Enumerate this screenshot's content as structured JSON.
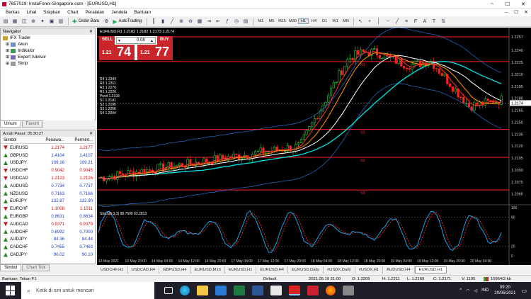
{
  "window": {
    "title": "7657019: InstaForex-Singapore.com - [EURUSD,H1]",
    "min": "–",
    "max": "☐",
    "close": "✕"
  },
  "menu": [
    "Berkas",
    "Lihat",
    "Sisipkan",
    "Chart",
    "Peralatan",
    "Jendela",
    "Bantuan"
  ],
  "toolbar": {
    "order_label": "Order Baru",
    "autotrading_label": "AutoTrading",
    "timeframes": [
      "M1",
      "M5",
      "M15",
      "M30",
      "H1",
      "H4",
      "D1",
      "W1",
      "MN"
    ],
    "active_tf": "H1"
  },
  "navigator": {
    "title": "Navigator",
    "items": [
      "IFX Trader",
      "Akun",
      "Indikator",
      "Expert Advisor",
      "Skrip"
    ],
    "tabs": [
      "Umum",
      "Favorit"
    ]
  },
  "market_watch": {
    "title": "Amati Pasar: 05:30:27",
    "columns": [
      "Simbol",
      "Penawa...",
      "Permint..."
    ],
    "rows": [
      {
        "sym": "EURUSD",
        "bid": "1.2174",
        "ask": "1.2177",
        "dir": "dn"
      },
      {
        "sym": "GBPUSD",
        "bid": "1.4104",
        "ask": "1.4107",
        "dir": "up"
      },
      {
        "sym": "USDJPY",
        "bid": "109.18",
        "ask": "109.21",
        "dir": "up"
      },
      {
        "sym": "USDCHF",
        "bid": "0.9042",
        "ask": "0.9045",
        "dir": "dn"
      },
      {
        "sym": "USDCAD",
        "bid": "1.2123",
        "ask": "1.2126",
        "dir": "dn"
      },
      {
        "sym": "AUDUSD",
        "bid": "0.7734",
        "ask": "0.7737",
        "dir": "up"
      },
      {
        "sym": "NZDUSD",
        "bid": "0.7163",
        "ask": "0.7166",
        "dir": "up"
      },
      {
        "sym": "EURJPY",
        "bid": "132.87",
        "ask": "132.90",
        "dir": "up"
      },
      {
        "sym": "EURCHF",
        "bid": "1.1008",
        "ask": "1.1011",
        "dir": "dn"
      },
      {
        "sym": "EURGBP",
        "bid": "0.8631",
        "ask": "0.8634",
        "dir": "up"
      },
      {
        "sym": "AUDCAD",
        "bid": "0.9371",
        "ask": "0.9379",
        "dir": "dn"
      },
      {
        "sym": "AUDCHF",
        "bid": "0.6992",
        "ask": "0.7000",
        "dir": "up"
      },
      {
        "sym": "AUDJPY",
        "bid": "84.36",
        "ask": "84.44",
        "dir": "up"
      },
      {
        "sym": "CADCHF",
        "bid": "0.7455",
        "ask": "0.7463",
        "dir": "up"
      },
      {
        "sym": "CADJPY",
        "bid": "90.02",
        "ask": "90.10",
        "dir": "up"
      }
    ],
    "tabs": [
      "Simbol",
      "Chart Tick"
    ]
  },
  "chart": {
    "info": "EURUSD,H1  1.2182 1.2182 1.2173 1.2174",
    "sell_label": "SELL",
    "buy_label": "BUY",
    "lot": "0.08",
    "sell_small": "1.21",
    "sell_big": "74",
    "buy_small": "1.21",
    "buy_big": "77",
    "pivot_text": [
      "R4 1.2344",
      "R3 1.2311",
      "R2 1.2276",
      "R1 1.2226",
      "Pivot 1.2193",
      "S1 1.2141",
      "S2 1.2106",
      "S3 1.2056",
      "S4 1.2004"
    ],
    "level_labels": [
      "R1",
      "S1",
      "S2",
      "S3"
    ],
    "yticks": [
      "1.2257",
      "1.2240",
      "1.2225",
      "1.2210",
      "1.2195",
      "1.2180",
      "1.2174",
      "1.2165",
      "1.2150",
      "1.2135",
      "1.2120",
      "1.2105",
      "1.2090",
      "1.2075",
      "1.2060"
    ],
    "xticks": [
      "13 May 2021",
      "13 May 20:00",
      "14 May 04:00",
      "14 May 12:00",
      "14 May 20:00",
      "17 May 04:00",
      "17 May 12:00",
      "17 May 20:00",
      "18 May 04:00",
      "18 May 12:00",
      "18 May 20:00",
      "19 May 04:00",
      "19 May 12:00",
      "19 May 20:00",
      "20 May 04:00"
    ],
    "stoch_label": "Stoch(5,3,3) 88.7500 63.2813",
    "stoch_ticks": [
      "100",
      "80",
      "20",
      "0"
    ],
    "tabs": [
      "USDCHF,H1",
      "USDCAD,H4",
      "GBPUSD,H4",
      "EURUSD,M15",
      "EURUSD,H1",
      "EURUSD,H4",
      "EURUSD,Daily",
      "#USDX,Daily",
      "#USDX,H1",
      "AUDUSD,H4",
      "EURUSD,H1"
    ],
    "active_tab": 10
  },
  "status": {
    "help": "Bantuan, Tekan F1",
    "profile": "Default",
    "time": "2021.05.19 21:00",
    "open": "O: 1.2209",
    "high": "H: 1.2211",
    "low": "L: 1.2169",
    "close": "C: 1.2171",
    "vol": "V: 1105",
    "conn": "10964/3 kb"
  },
  "taskbar": {
    "search": "Ketik di sini untuk mencari",
    "lang": "IND",
    "time": "09.20",
    "date": "20/05/2021"
  },
  "colors": {
    "bull": "#2ecc40",
    "bear": "#ff2020",
    "line_cyan": "#00e5e5",
    "line_red": "#ff3030",
    "line_orange": "#ff9900",
    "line_white": "#ffffff",
    "line_blue": "#2c6fd6"
  }
}
